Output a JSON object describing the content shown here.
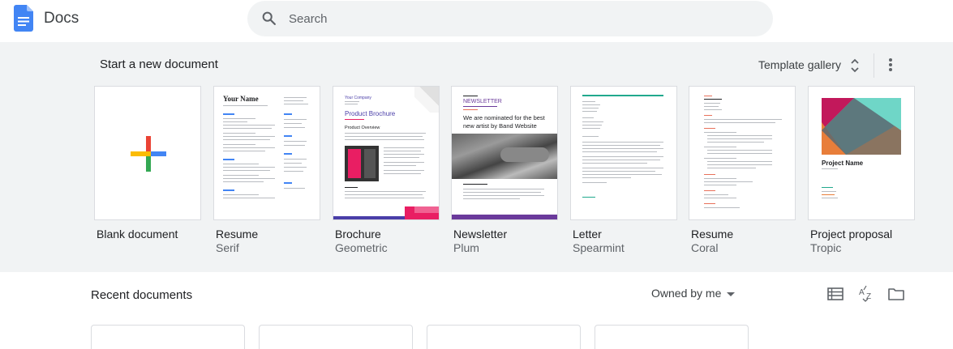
{
  "header": {
    "app_name": "Docs",
    "search_placeholder": "Search"
  },
  "templates": {
    "title": "Start a new document",
    "gallery_label": "Template gallery",
    "items": [
      {
        "name": "Blank document",
        "sub": ""
      },
      {
        "name": "Resume",
        "sub": "Serif"
      },
      {
        "name": "Brochure",
        "sub": "Geometric"
      },
      {
        "name": "Newsletter",
        "sub": "Plum"
      },
      {
        "name": "Letter",
        "sub": "Spearmint"
      },
      {
        "name": "Resume",
        "sub": "Coral"
      },
      {
        "name": "Project proposal",
        "sub": "Tropic"
      }
    ],
    "thumb_text": {
      "resume_serif_name": "Your Name",
      "brochure_company": "Your Company",
      "brochure_title": "Product Brochure",
      "brochure_overview": "Product Overview",
      "newsletter_title": "NEWSLETTER",
      "newsletter_headline": "We are nominated for the best new artist by Band Website",
      "proposal_title": "Project Name"
    }
  },
  "recent": {
    "title": "Recent documents",
    "owner_filter": "Owned by me"
  },
  "colors": {
    "accent_blue": "#4285f4",
    "google_red": "#ea4335",
    "google_yellow": "#fbbc04",
    "google_green": "#34a853",
    "plum": "#6a3a9b",
    "spearmint": "#21a98d",
    "coral": "#e8715b",
    "brochure_magenta": "#e91e63",
    "brochure_blue": "#4a3ea8",
    "tropic_teal": "#6fd6c7"
  }
}
